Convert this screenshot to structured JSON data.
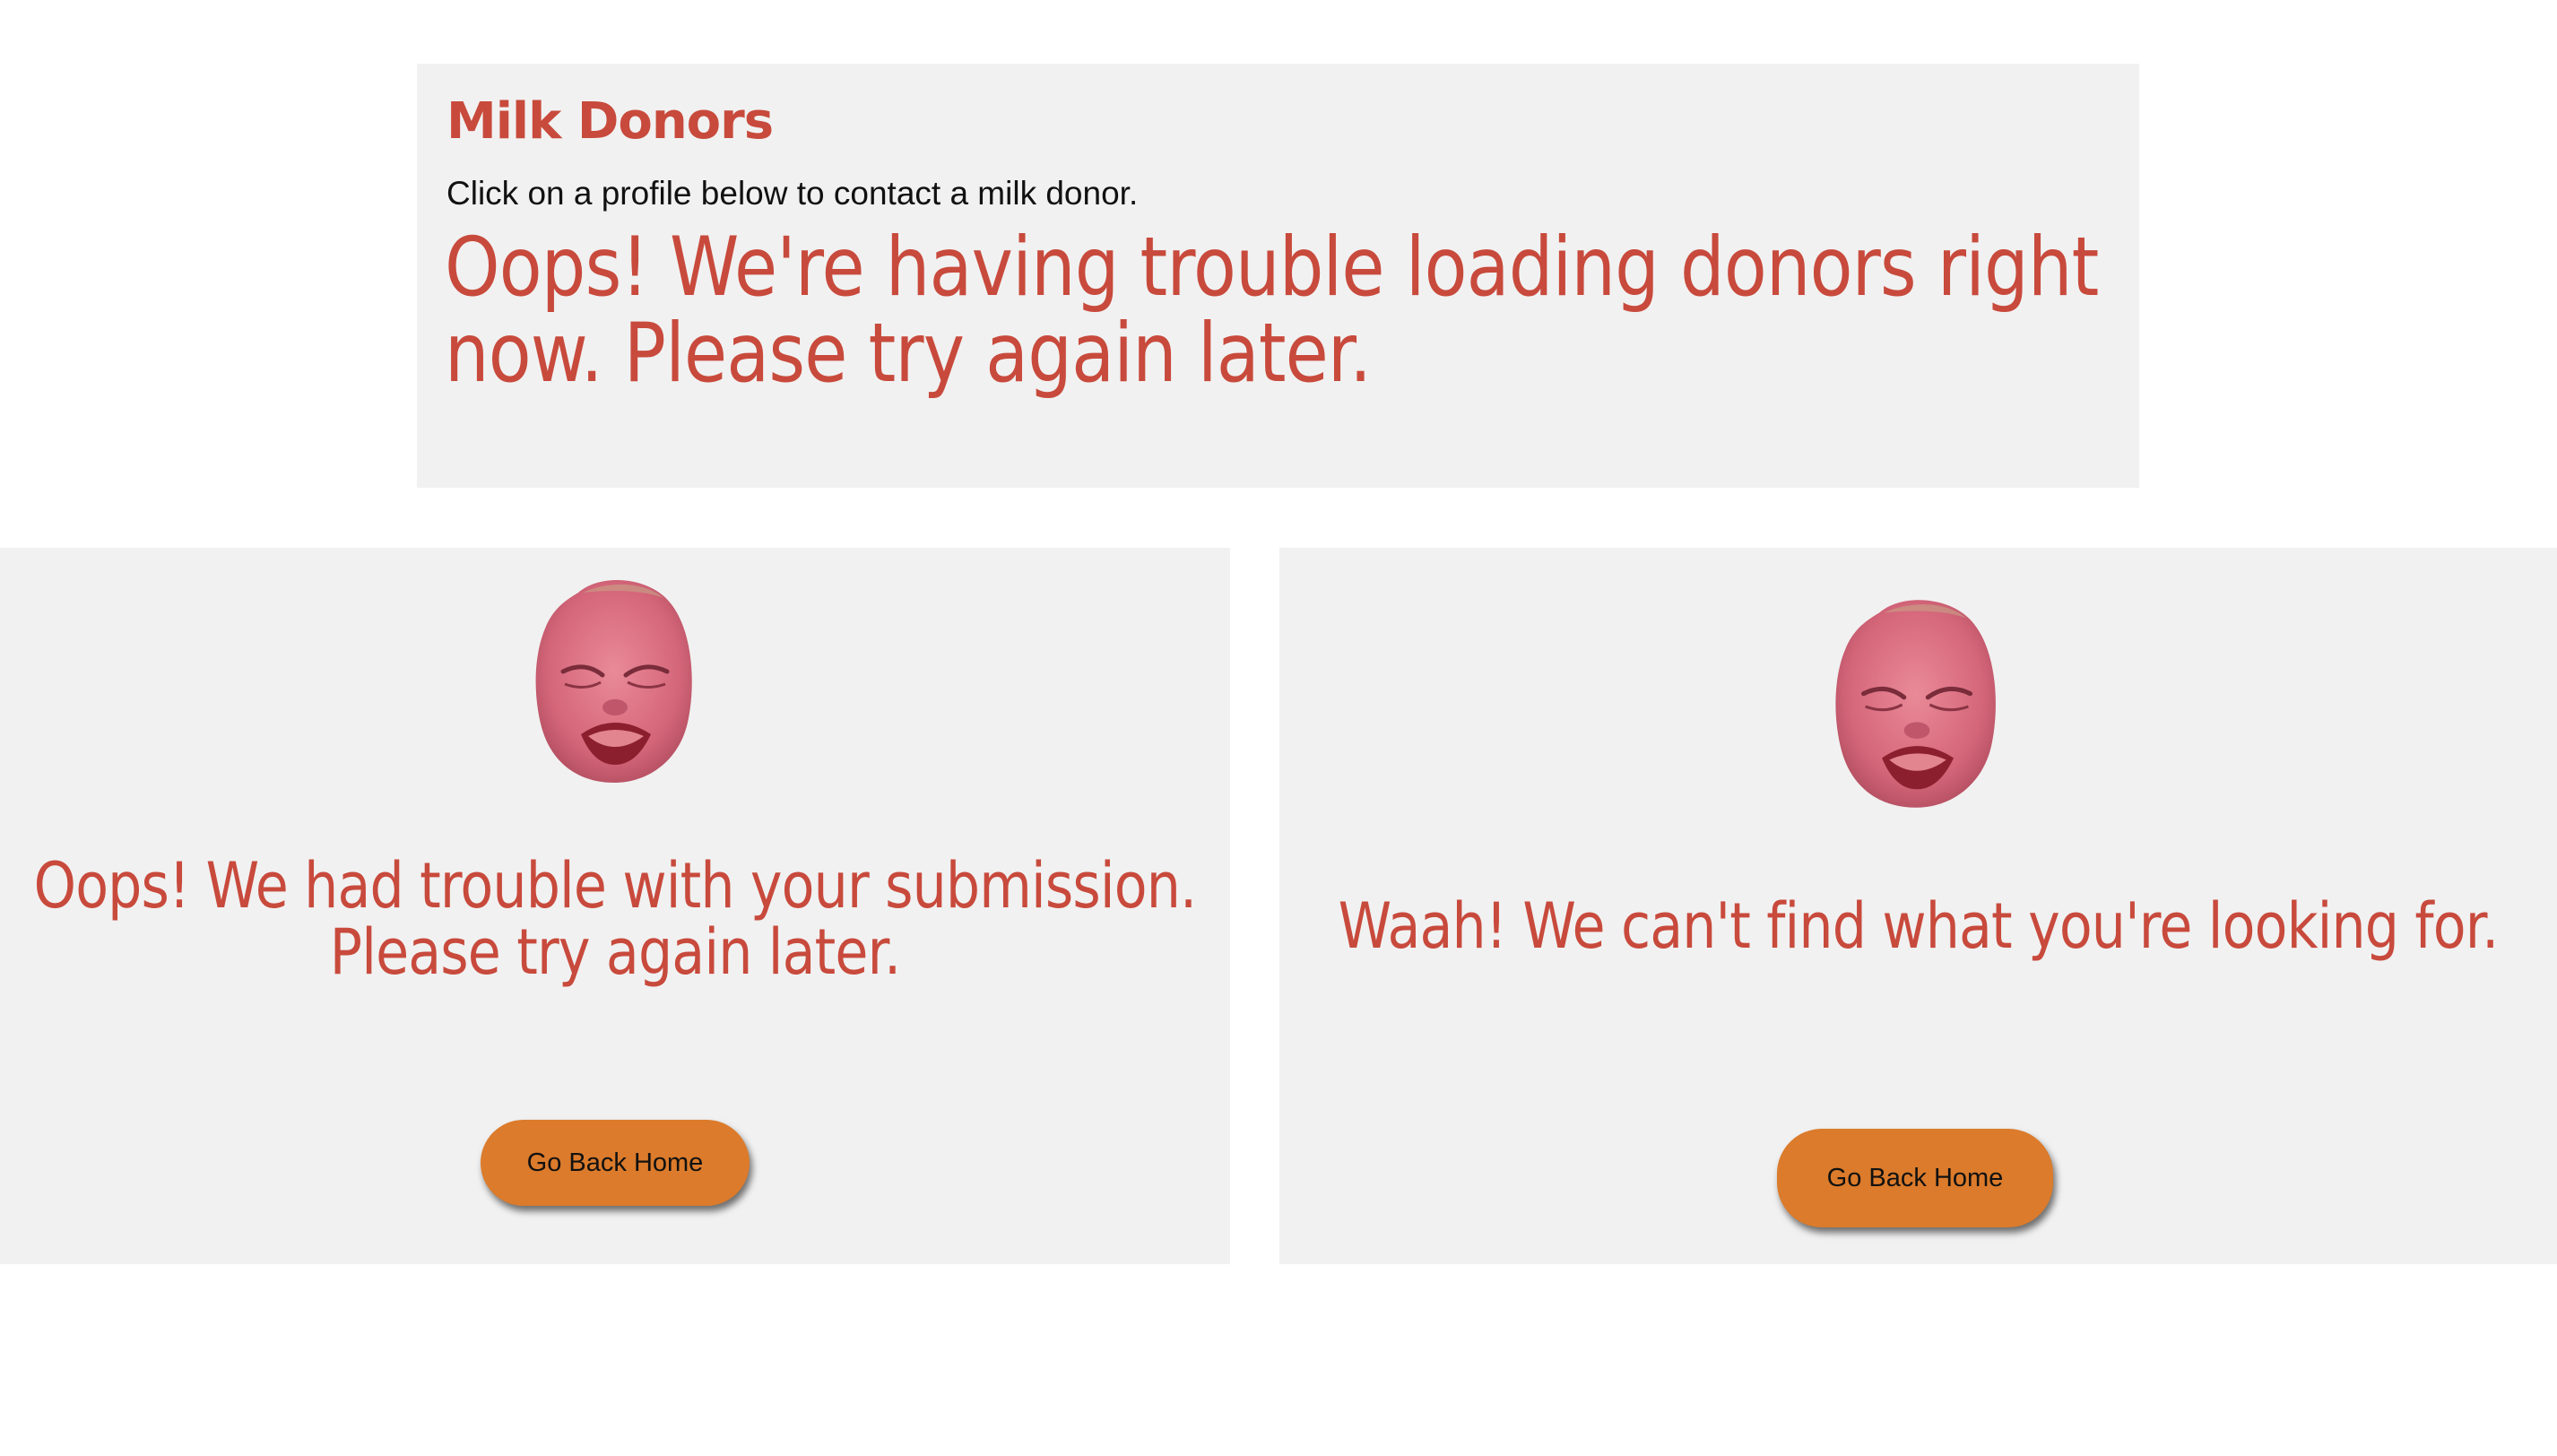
{
  "donors_panel": {
    "title": "Milk Donors",
    "subtitle": "Click on a profile below to contact a milk donor.",
    "error_message": "Oops! We're having trouble loading donors right now. Please try again later."
  },
  "submission_panel": {
    "image_icon": "crying-baby-icon",
    "message": "Oops! We had trouble with your submission. Please try again later.",
    "button_label": "Go Back Home"
  },
  "notfound_panel": {
    "image_icon": "crying-baby-icon",
    "message": "Waah! We can't find what you're looking for.",
    "button_label": "Go Back Home"
  },
  "colors": {
    "accent_red": "#c84a3c",
    "button_orange": "#db7b2b",
    "panel_gray": "#f1f1f1"
  }
}
